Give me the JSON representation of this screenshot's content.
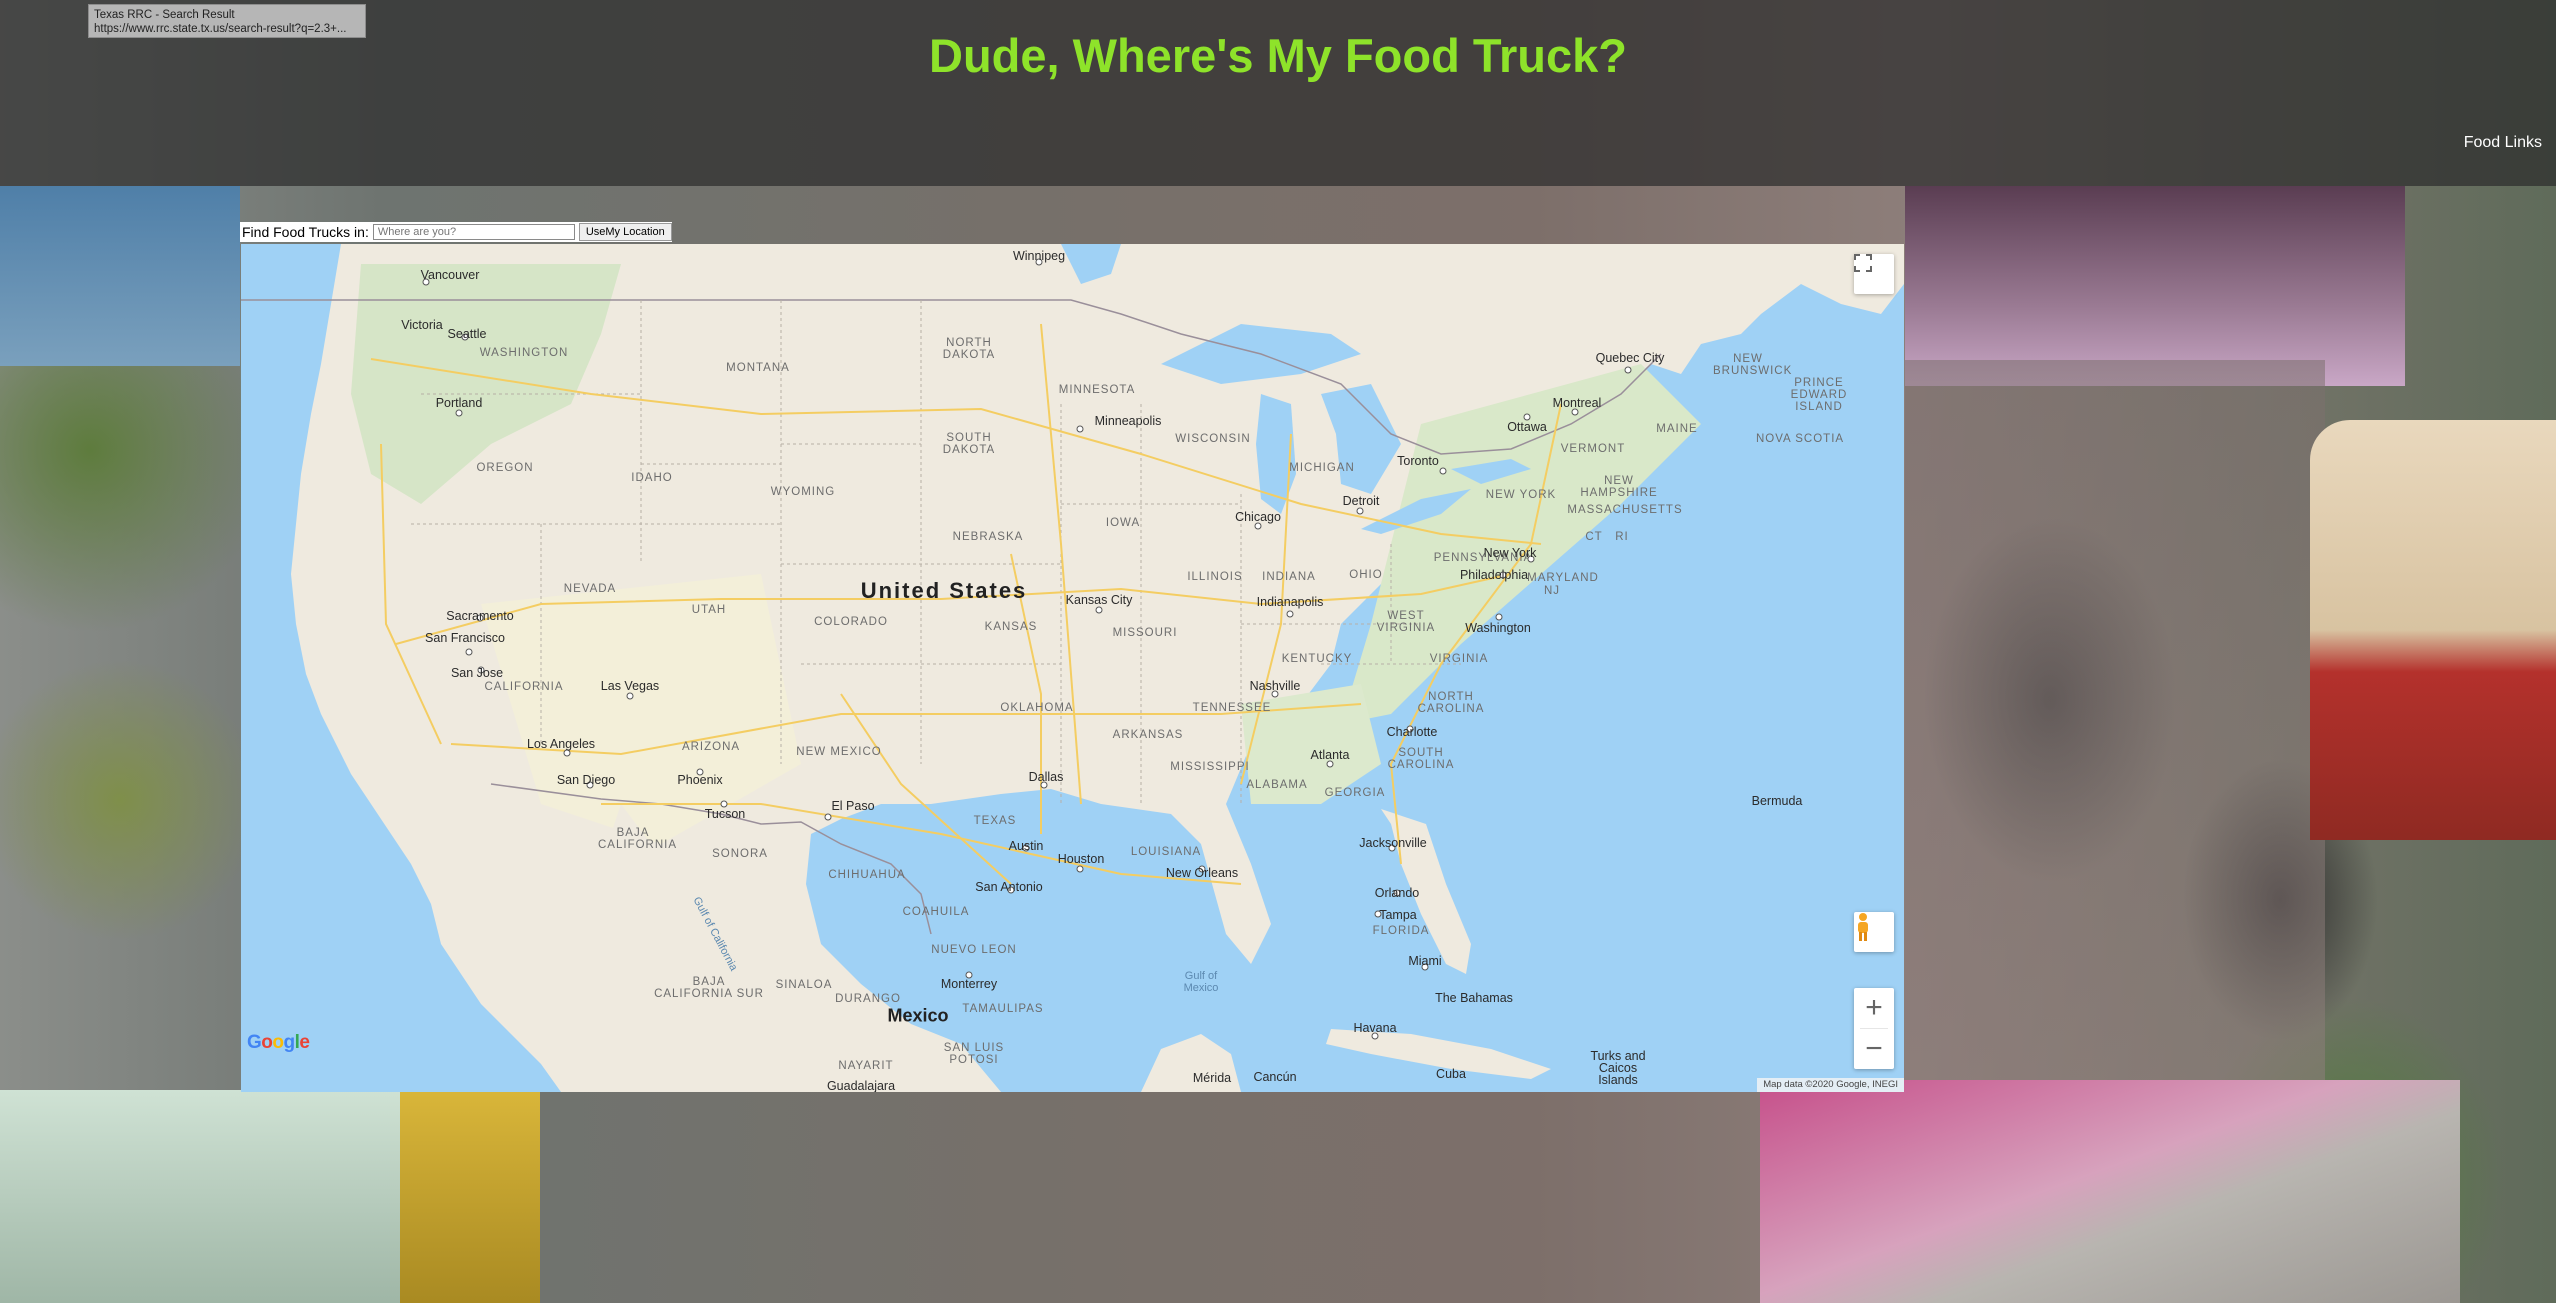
{
  "tooltip": {
    "title": "Texas RRC - Search Result",
    "url": "https://www.rrc.state.tx.us/search-result?q=2.3+..."
  },
  "header": {
    "title": "Dude, Where's My Food Truck?",
    "title_color": "#8ee32a",
    "nav_link": "Food Links"
  },
  "search": {
    "label": "Find Food Trucks in:",
    "placeholder": "Where are you?",
    "value": "",
    "button_label": "UseMy Location"
  },
  "map": {
    "country_label": "United States",
    "major_labels": [
      "Mexico"
    ],
    "states": [
      "WASHINGTON",
      "MONTANA",
      "NORTH DAKOTA",
      "MINNESOTA",
      "OREGON",
      "IDAHO",
      "SOUTH DAKOTA",
      "WYOMING",
      "WISCONSIN",
      "MICHIGAN",
      "NEBRASKA",
      "IOWA",
      "NEVADA",
      "UTAH",
      "COLORADO",
      "ILLINOIS",
      "INDIANA",
      "OHIO",
      "PENNSYLVANIA",
      "NEW YORK",
      "CALIFORNIA",
      "KANSAS",
      "MISSOURI",
      "KENTUCKY",
      "WEST VIRGINIA",
      "VIRGINIA",
      "ARIZONA",
      "NEW MEXICO",
      "OKLAHOMA",
      "TENNESSEE",
      "NORTH CAROLINA",
      "ARKANSAS",
      "SOUTH CAROLINA",
      "MISSISSIPPI",
      "ALABAMA",
      "GEORGIA",
      "TEXAS",
      "LOUISIANA",
      "FLORIDA",
      "MAINE",
      "VERMONT",
      "NEW HAMPSHIRE",
      "MASSACHUSETTS",
      "CT",
      "RI",
      "NJ",
      "MARYLAND",
      "NEW BRUNSWICK",
      "PRINCE EDWARD ISLAND",
      "NOVA SCOTIA",
      "BAJA CALIFORNIA",
      "SONORA",
      "CHIHUAHUA",
      "COAHUILA",
      "NUEVO LEON",
      "BAJA CALIFORNIA SUR",
      "SINALOA",
      "DURANGO",
      "TAMAULIPAS",
      "SAN LUIS POTOSI",
      "NAYARIT"
    ],
    "cities": [
      "Winnipeg",
      "Vancouver",
      "Victoria",
      "Seattle",
      "Portland",
      "Minneapolis",
      "Quebec City",
      "Montreal",
      "Ottawa",
      "Toronto",
      "Detroit",
      "Chicago",
      "Sacramento",
      "San Francisco",
      "San Jose",
      "Las Vegas",
      "Kansas City",
      "Indianapolis",
      "Philadelphia",
      "New York",
      "Washington",
      "Los Angeles",
      "San Diego",
      "Phoenix",
      "Tucson",
      "El Paso",
      "Nashville",
      "Charlotte",
      "Atlanta",
      "Dallas",
      "Austin",
      "Houston",
      "San Antonio",
      "New Orleans",
      "Jacksonville",
      "Orlando",
      "Tampa",
      "Miami",
      "Monterrey",
      "Havana",
      "Cuba",
      "Mérida",
      "Cancún",
      "Guadalajara",
      "Bermuda",
      "The Bahamas",
      "Turks and Caicos Islands"
    ],
    "water": [
      "Gulf of Mexico",
      "Gulf of California"
    ],
    "logo": "Google",
    "attribution": "Map data ©2020 Google, INEGI",
    "zoom_in": "+",
    "zoom_out": "−"
  }
}
